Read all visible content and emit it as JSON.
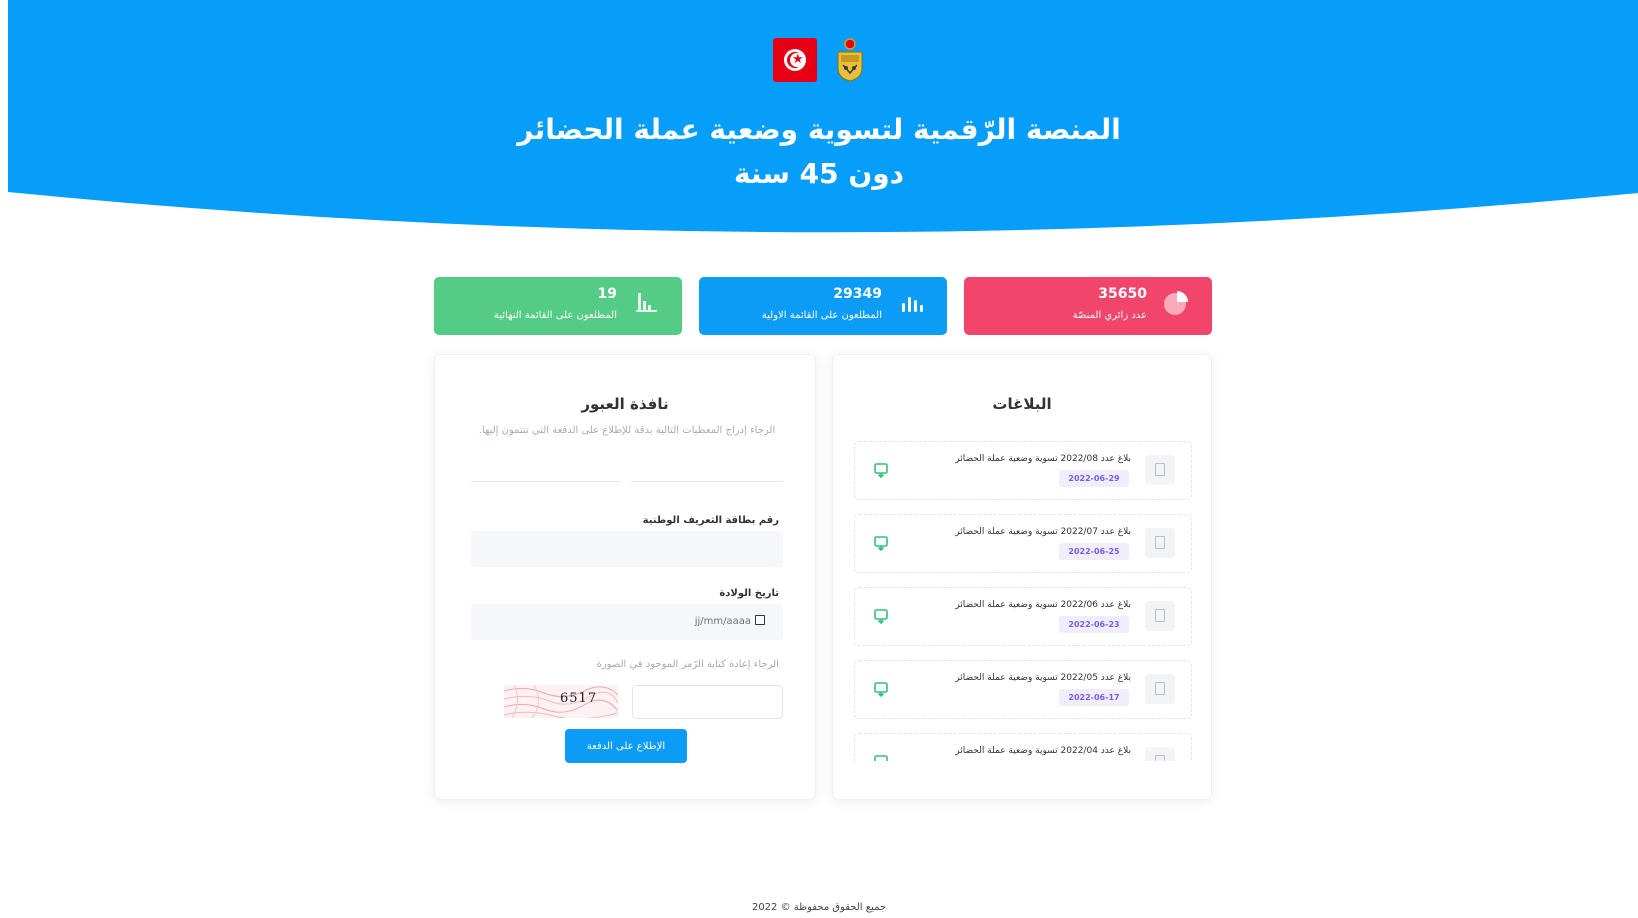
{
  "header": {
    "title_line1": "المنصة الرّقمية لتسوية وضعية عملة الحضائر",
    "title_line2": "دون 45 سنة",
    "emblems": [
      "tunisia-flag-icon",
      "coat-of-arms-icon"
    ],
    "background_color": "#069ef8"
  },
  "stats": [
    {
      "value": "19",
      "label": "المطلعون على القائمة النهائية",
      "icon": "bar-chart-icon",
      "color": "#55cc86"
    },
    {
      "value": "29349",
      "label": "المطلعون على القائمة الاولية",
      "icon": "bars-icon",
      "color": "#0c9cf5"
    },
    {
      "value": "35650",
      "label": "عدد زائري المنصّة",
      "icon": "pie-chart-icon",
      "color": "#f2456c"
    }
  ],
  "login": {
    "title": "نافذة العبور",
    "subtitle": "الرجاء إدراج المعطيات التالية بدقة للإطلاع على الدفعة التي تنتمون إليها.",
    "cin_label": "رقم بطاقة التعريف الوطنية",
    "cin_value": "",
    "dob_label": "تاريخ الولادة",
    "dob_placeholder": "jj/mm/aaaa",
    "captcha_note": "الرجاء إعادة كتابة الرّمز الموجود في الصورة",
    "captcha_code": "6517",
    "captcha_value": "",
    "submit_label": "الإطلاع على الدفعة"
  },
  "news": {
    "title": "البلاغات",
    "items": [
      {
        "title": "بلاغ عدد 2022/08 تسوية وضعية عملة الحضائر",
        "date": "2022-06-29"
      },
      {
        "title": "بلاغ عدد 2022/07 تسوية وضعية عملة الحضائر",
        "date": "2022-06-25"
      },
      {
        "title": "بلاغ عدد 2022/06 تسوية وضعية عملة الحضائر",
        "date": "2022-06-23"
      },
      {
        "title": "بلاغ عدد 2022/05 تسوية وضعية عملة الحضائر",
        "date": "2022-06-17"
      },
      {
        "title": "بلاغ عدد 2022/04 تسوية وضعية عملة الحضائر",
        "date": ""
      }
    ]
  },
  "footer": {
    "text": "جميع الحقوق محفوظة © 2022"
  },
  "colors": {
    "primary": "#0c9cf5",
    "success": "#55cc86",
    "danger": "#f2456c",
    "date_badge": "#7b5ce6"
  }
}
